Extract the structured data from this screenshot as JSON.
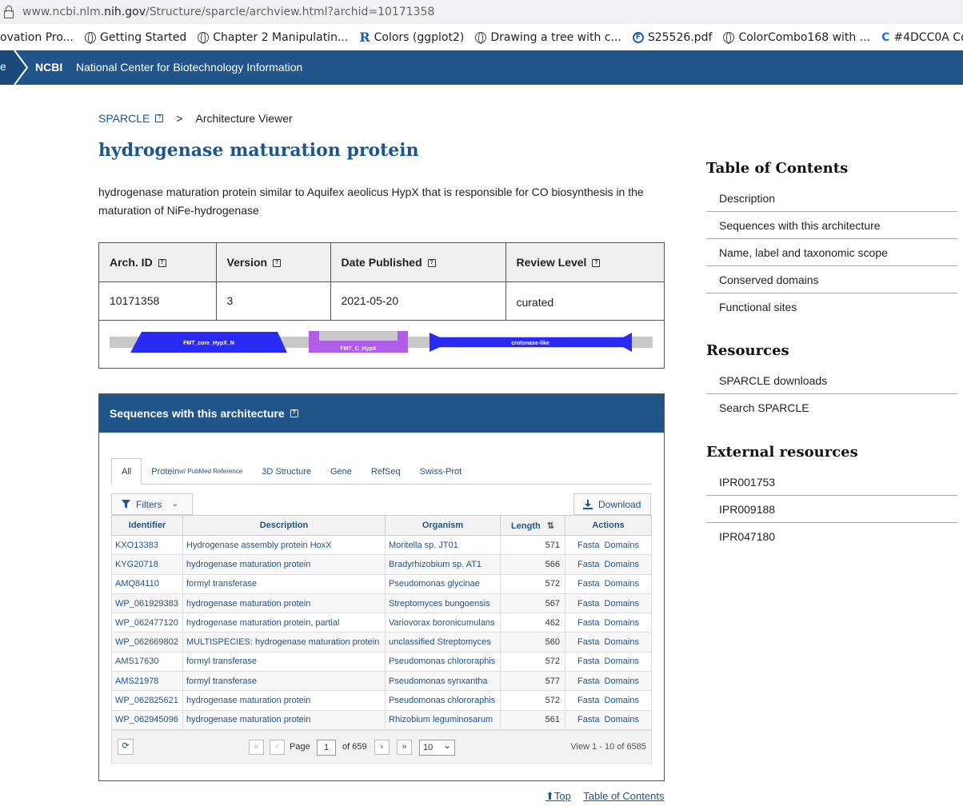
{
  "browser": {
    "url_prefix": "www.ncbi.nlm.",
    "url_domain": "nih.gov",
    "url_path": "/Structure/sparcle/archview.html?archid=10171358",
    "bookmarks": [
      {
        "label": "ovation Pro...",
        "icon": "none"
      },
      {
        "label": "Getting Started",
        "icon": "globe-icon"
      },
      {
        "label": "Chapter 2 Manipulatin...",
        "icon": "globe-icon"
      },
      {
        "label": "Colors (ggplot2)",
        "icon": "r-icon"
      },
      {
        "label": "Drawing a tree with c...",
        "icon": "globe-icon"
      },
      {
        "label": "S25526.pdf",
        "icon": "f-icon"
      },
      {
        "label": "ColorCombo168 with ...",
        "icon": "globe-icon"
      },
      {
        "label": "#4DCC0A Color",
        "icon": "c-icon"
      }
    ]
  },
  "header": {
    "logo": "NCBI",
    "name": "National Center for Biotechnology Information",
    "e": "e"
  },
  "breadcrumb": {
    "root": "SPARCLE",
    "sep": ">",
    "current": "Architecture Viewer"
  },
  "page": {
    "title": "hydrogenase maturation protein",
    "description": "hydrogenase maturation protein similar to Aquifex aeolicus HypX that is responsible for CO biosynthesis in the maturation of NiFe-hydrogenase"
  },
  "arch": {
    "headers": [
      "Arch. ID",
      "Version",
      "Date Published",
      "Review Level"
    ],
    "values": [
      "10171358",
      "3",
      "2021-05-20",
      "curated"
    ],
    "domains": [
      {
        "label": "FMT_core_HypX_N",
        "color": "#2a2af5"
      },
      {
        "label": "FMT_C_HypX",
        "color": "#b05ee8"
      },
      {
        "label": "crotonase-like",
        "color": "#2a2af5"
      }
    ]
  },
  "sequences": {
    "title": "Sequences with this architecture",
    "tabs": [
      {
        "label": "All",
        "sub": ""
      },
      {
        "label": "Protein",
        "sub": "w/ PubMed Reference"
      },
      {
        "label": "3D Structure",
        "sub": ""
      },
      {
        "label": "Gene",
        "sub": ""
      },
      {
        "label": "RefSeq",
        "sub": ""
      },
      {
        "label": "Swiss-Prot",
        "sub": ""
      }
    ],
    "filters_label": "Filters",
    "download_label": "Download",
    "columns": [
      "Identifier",
      "Description",
      "Organism",
      "Length",
      "Actions"
    ],
    "rows": [
      [
        "KXO13383",
        "Hydrogenase assembly protein HoxX",
        "Moritella sp. JT01",
        "571"
      ],
      [
        "KYG20718",
        "hydrogenase maturation protein",
        "Bradyrhizobium sp. AT1",
        "566"
      ],
      [
        "AMQ84110",
        "formyl transferase",
        "Pseudomonas glycinae",
        "572"
      ],
      [
        "WP_061929383",
        "hydrogenase maturation protein",
        "Streptomyces bungoensis",
        "567"
      ],
      [
        "WP_062477120",
        "hydrogenase maturation protein, partial",
        "Variovorax boronicumulans",
        "462"
      ],
      [
        "WP_062669802",
        "MULTISPECIES: hydrogenase maturation protein",
        "unclassified Streptomyces",
        "560"
      ],
      [
        "AMS17630",
        "formyl transferase",
        "Pseudomonas chlororaphis",
        "572"
      ],
      [
        "AMS21978",
        "formyl transferase",
        "Pseudomonas synxantha",
        "577"
      ],
      [
        "WP_062825621",
        "hydrogenase maturation protein",
        "Pseudomonas chlororaphis",
        "572"
      ],
      [
        "WP_062945096",
        "hydrogenase maturation protein",
        "Rhizobium leguminosarum",
        "561"
      ]
    ],
    "action_fasta": "Fasta",
    "action_domains": "Domains",
    "pager": {
      "page_label": "Page",
      "page": "1",
      "of": "of 659",
      "per_page": "10",
      "view": "View 1 - 10 of 6585"
    }
  },
  "footer": {
    "top": "Top",
    "toc": "Table of Contents"
  },
  "sidebar": {
    "toc_title": "Table of Contents",
    "toc": [
      "Description",
      "Sequences with this architecture",
      "Name, label and taxonomic scope",
      "Conserved domains",
      "Functional sites"
    ],
    "res_title": "Resources",
    "resources": [
      "SPARCLE downloads",
      "Search SPARCLE"
    ],
    "ext_title": "External resources",
    "external": [
      "IPR001753",
      "IPR009188",
      "IPR047180"
    ]
  },
  "colors": {
    "ncbi_blue": "#20558a",
    "domain_blue": "#2a2af5",
    "domain_purple": "#b05ee8"
  }
}
